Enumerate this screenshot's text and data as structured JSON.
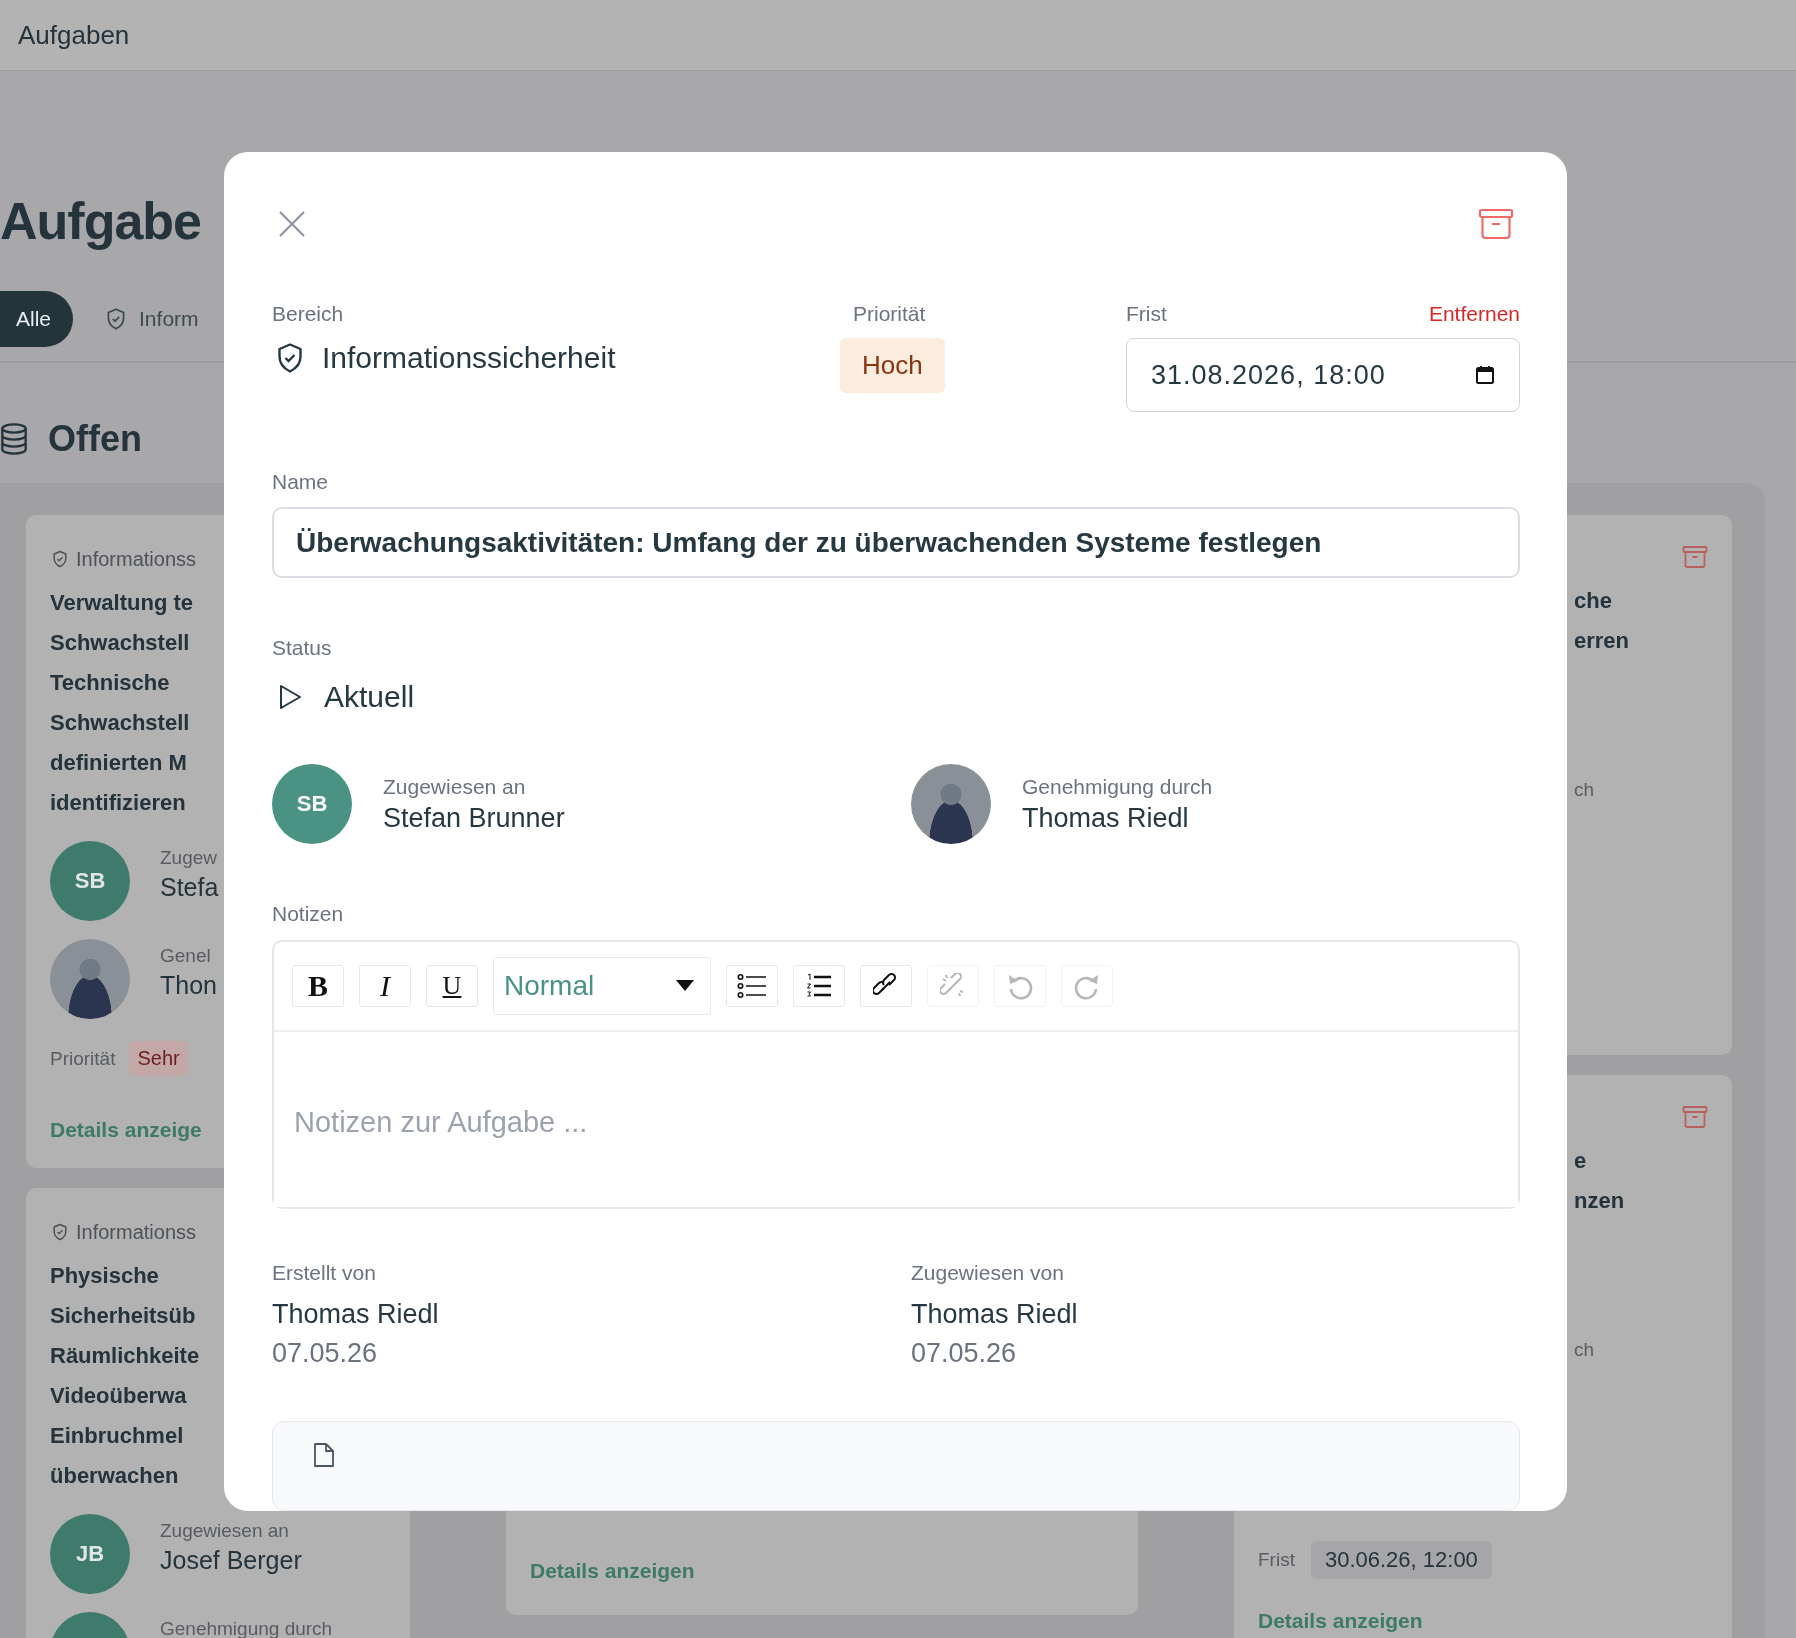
{
  "page": {
    "title": "Aufgaben"
  },
  "background": {
    "heading": "Aufgabe",
    "filters": [
      {
        "label": "Alle",
        "selected": true,
        "icon": false
      },
      {
        "label": "Inform",
        "selected": false,
        "icon": true
      }
    ],
    "section": "Offen",
    "left_cards": [
      {
        "area": "Informationss",
        "title_lines": [
          "Verwaltung te",
          "Schwachstell",
          "Technische",
          "Schwachstell",
          "definierten M",
          "identifizieren"
        ],
        "assignee": {
          "photo": false,
          "initials": "SB",
          "label": "Zugew",
          "name": "Stefa"
        },
        "approver": {
          "photo": true,
          "label": "Genel",
          "name": "Thon"
        },
        "priority_label": "Priorität",
        "priority": "Sehr",
        "details": "Details anzeige"
      },
      {
        "area": "Informationss",
        "title_lines": [
          "Physische",
          "Sicherheitsüb",
          "Räumlichkeite",
          "Videoüberwa",
          "Einbruchmel",
          "überwachen"
        ],
        "assignee": {
          "photo": false,
          "initials": "JB",
          "label": "Zugewiesen an",
          "name": "Josef Berger"
        },
        "approver": {
          "photo": false,
          "label": "Genehmigung durch"
        }
      }
    ],
    "middle_card": {
      "details": "Details anzeigen"
    },
    "right_cards": [
      {
        "title_lines": [
          "che",
          "erren"
        ],
        "note": "ch"
      },
      {
        "title_lines": [
          "e",
          "nzen"
        ],
        "note": "ch",
        "deadline_label": "Frist",
        "deadline": "30.06.26, 12:00",
        "details": "Details anzeigen"
      }
    ]
  },
  "dialog": {
    "area": {
      "label": "Bereich",
      "value": "Informationssicherheit"
    },
    "priority": {
      "label": "Priorität",
      "value": "Hoch"
    },
    "deadline": {
      "label": "Frist",
      "remove": "Entfernen",
      "value": "31.08.2026, 18:00"
    },
    "name": {
      "label": "Name",
      "value": "Überwachungsaktivitäten: Umfang der zu überwachenden Systeme festlegen"
    },
    "status": {
      "label": "Status",
      "value": "Aktuell"
    },
    "assigned_to": {
      "label": "Zugewiesen an",
      "name": "Stefan Brunner",
      "photo": false,
      "initials": "SB"
    },
    "approval_by": {
      "label": "Genehmigung durch",
      "name": "Thomas Riedl",
      "photo": true
    },
    "notes": {
      "label": "Notizen",
      "placeholder": "Notizen zur Aufgabe ...",
      "toolbar": [
        {
          "kind": "bold",
          "label": "B",
          "disabled": false
        },
        {
          "kind": "italic",
          "label": "I",
          "disabled": false
        },
        {
          "kind": "underline",
          "label": "U",
          "disabled": false
        },
        {
          "kind": "format",
          "value": "Normal",
          "disabled": false
        },
        {
          "kind": "bullet_list",
          "disabled": false
        },
        {
          "kind": "ordered_list",
          "disabled": false
        },
        {
          "kind": "link",
          "disabled": false
        },
        {
          "kind": "unlink",
          "disabled": true
        },
        {
          "kind": "undo",
          "disabled": true
        },
        {
          "kind": "redo",
          "disabled": true
        }
      ]
    },
    "created": {
      "label": "Erstellt von",
      "name": "Thomas Riedl",
      "date": "07.05.26"
    },
    "assigned_by": {
      "label": "Zugewiesen von",
      "name": "Thomas Riedl",
      "date": "07.05.26"
    }
  }
}
